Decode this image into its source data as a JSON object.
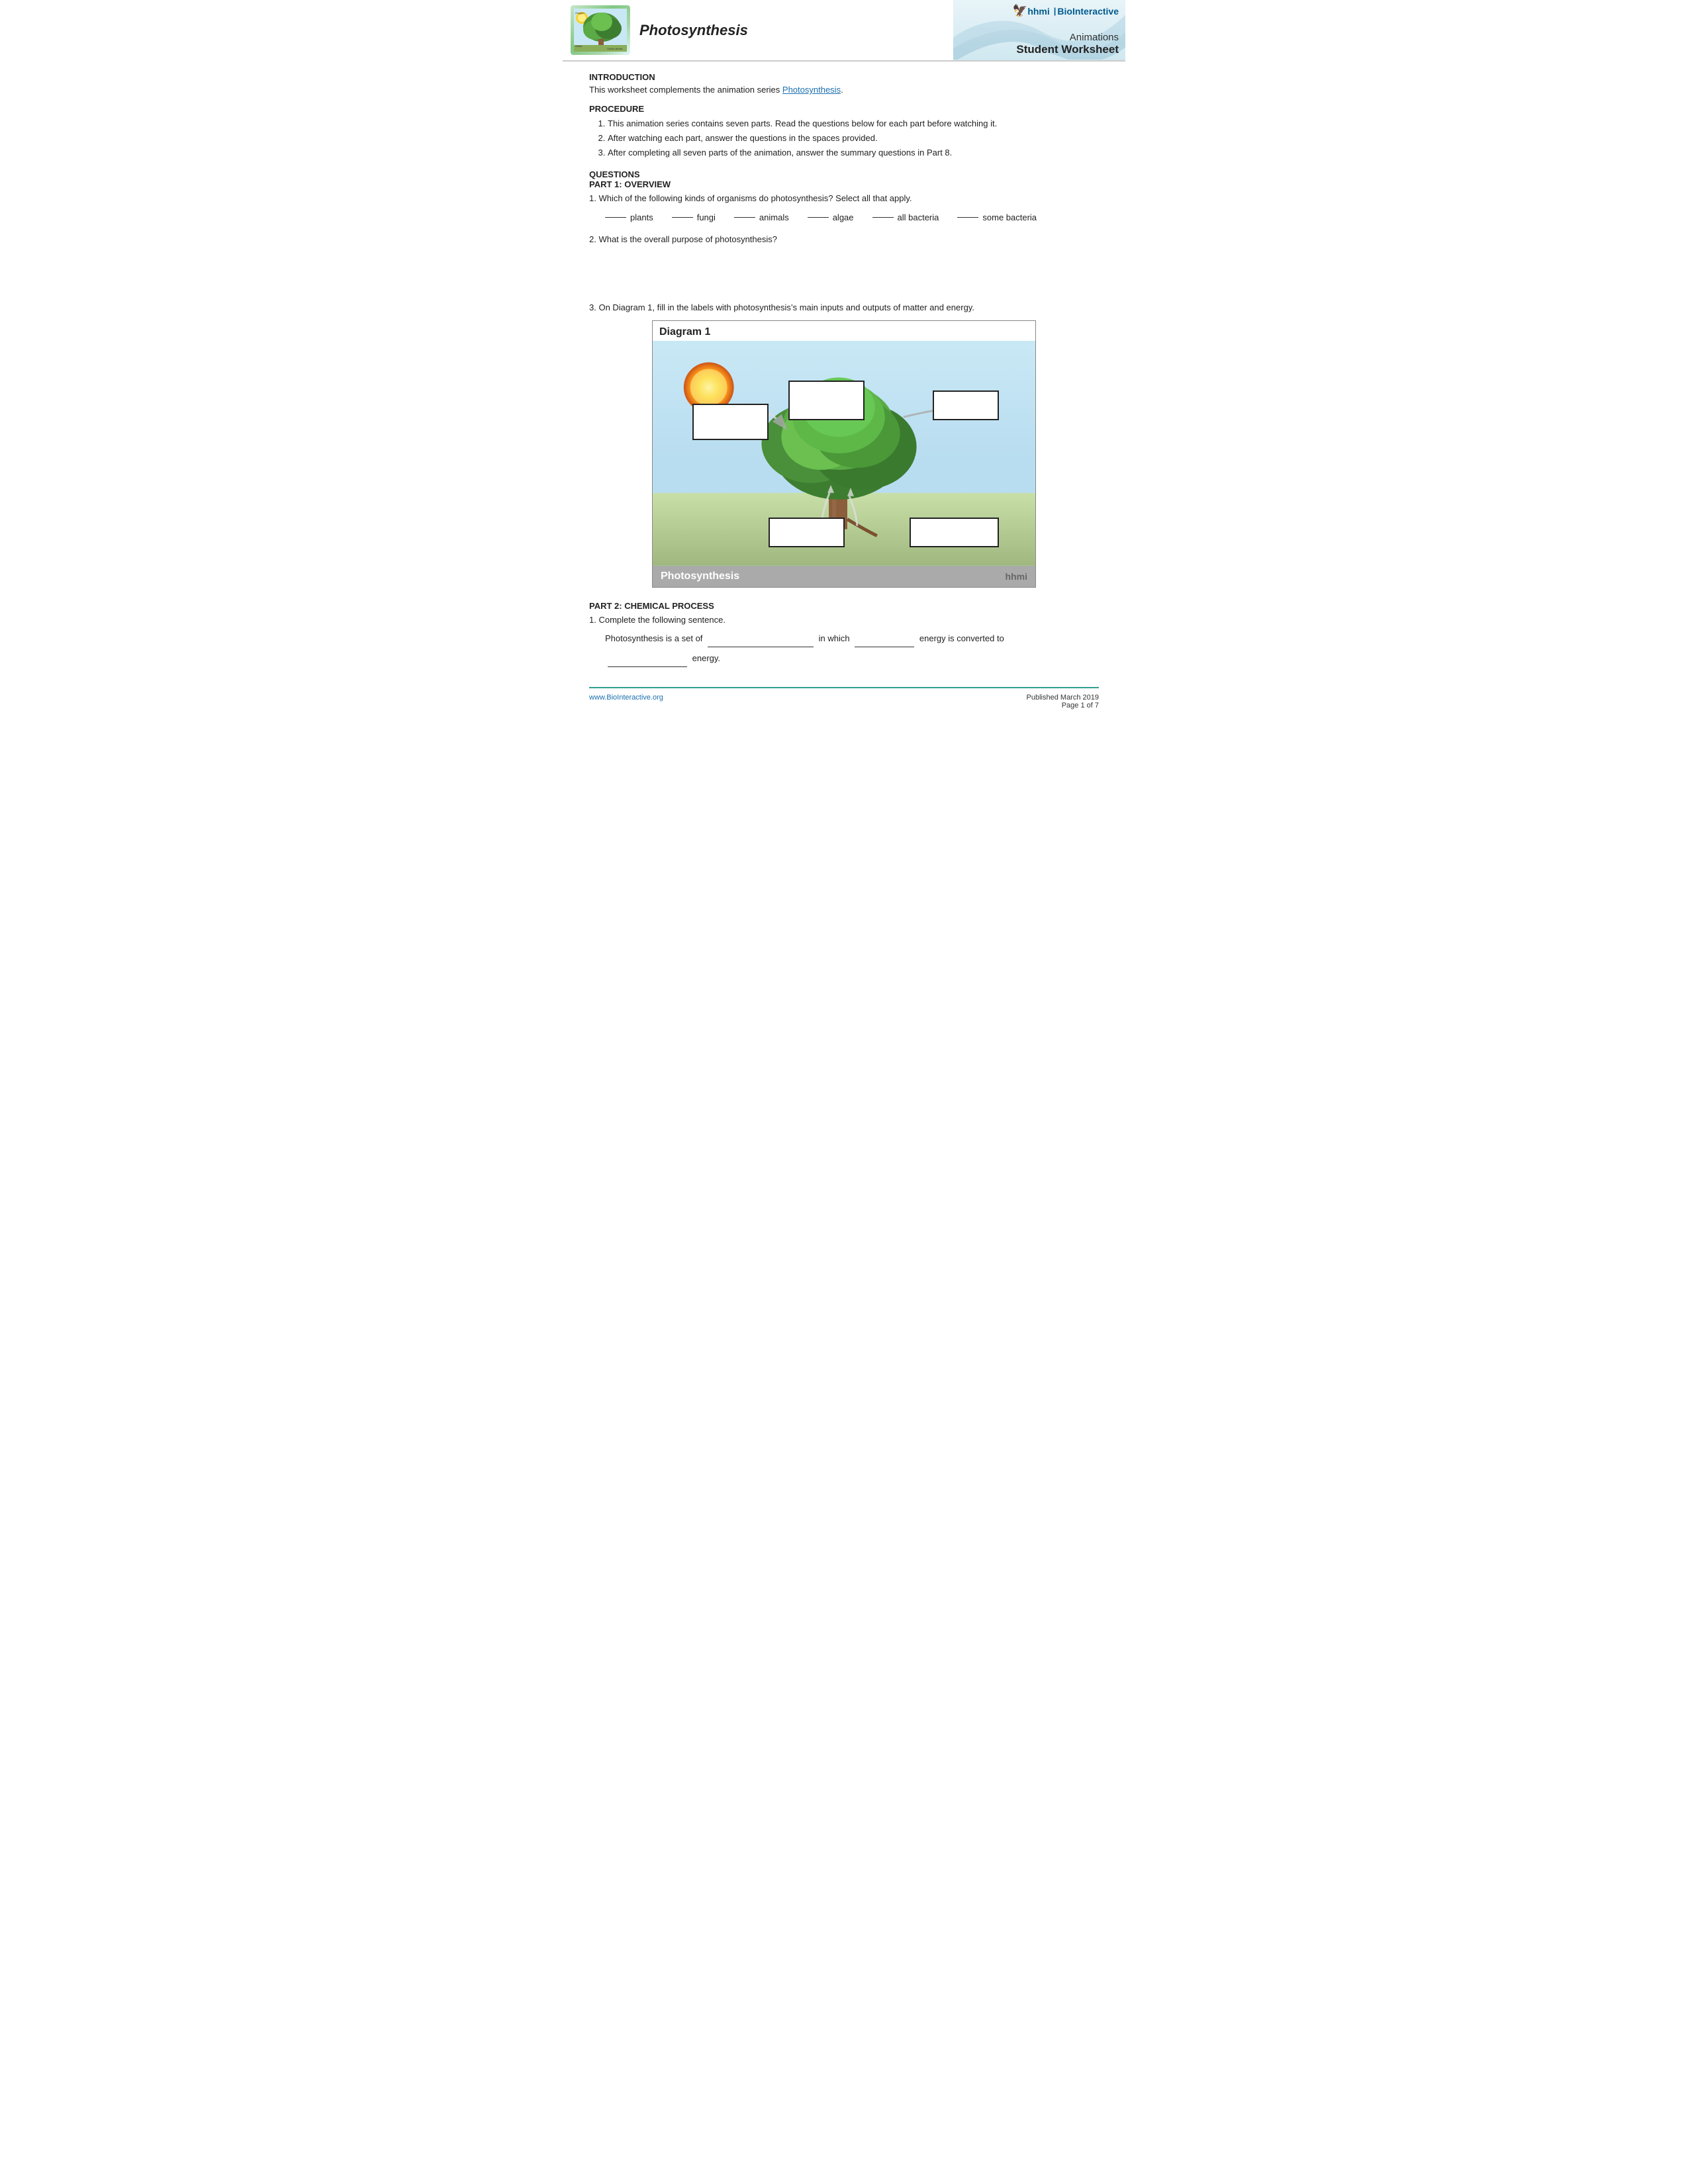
{
  "header": {
    "title": "Photosynthesis",
    "hhmi": "hhmi",
    "pipe": "|",
    "bio": "BioInteractive",
    "animations": "Animations",
    "student_worksheet": "Student Worksheet"
  },
  "intro": {
    "section": "INTRODUCTION",
    "text1": "This worksheet complements the animation series ",
    "link_text": "Photosynthesis",
    "text2": "."
  },
  "procedure": {
    "section": "PROCEDURE",
    "items": [
      "This animation series contains seven parts. Read the questions below for each part before watching it.",
      "After watching each part, answer the questions in the spaces provided.",
      "After completing all seven parts of the animation, answer the summary questions in Part 8."
    ]
  },
  "questions": {
    "section": "QUESTIONS",
    "part1": {
      "label": "PART 1: OVERVIEW",
      "q1": {
        "text": "1.  Which of the following kinds of organisms do photosynthesis? Select all that apply.",
        "organisms": [
          "plants",
          "fungi",
          "animals",
          "algae",
          "all bacteria",
          "some bacteria"
        ]
      },
      "q2": {
        "text": "2.   What is the overall purpose of photosynthesis?"
      },
      "q3": {
        "text": "3.   On Diagram 1, fill in the labels with photosynthesis’s main inputs and outputs of matter and energy."
      }
    },
    "diagram": {
      "title": "Diagram 1",
      "footer_title": "Photosynthesis",
      "footer_brand": "hhmi"
    },
    "part2": {
      "label": "PART 2: CHEMICAL PROCESS",
      "q1_text": "1.  Complete the following sentence.",
      "sentence1_pre": "Photosynthesis is a set of",
      "sentence1_mid": "in which",
      "sentence1_end": "energy is converted to",
      "sentence2_end": "energy."
    }
  },
  "footer": {
    "website": "www.BioInteractive.org",
    "published": "Published March 2019",
    "page": "Page 1 of 7"
  }
}
